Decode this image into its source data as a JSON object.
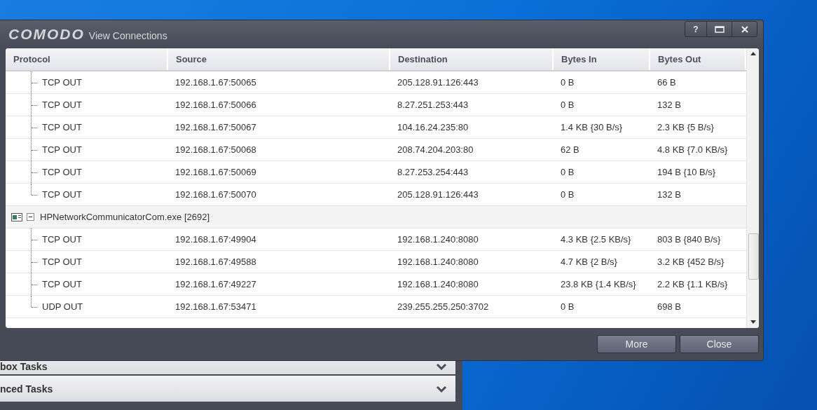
{
  "background_window": {
    "sections": [
      {
        "label": "box Tasks"
      },
      {
        "label": "nced Tasks"
      }
    ]
  },
  "window": {
    "brand": "COMODO",
    "title": "View Connections",
    "help": "?"
  },
  "table": {
    "columns": [
      "Protocol",
      "Source",
      "Destination",
      "Bytes In",
      "Bytes Out"
    ],
    "groups": [
      {
        "children": [
          {
            "protocol": "TCP OUT",
            "source": "192.168.1.67:50065",
            "destination": "205.128.91.126:443",
            "bytes_in": "0 B",
            "bytes_out": "66 B"
          },
          {
            "protocol": "TCP OUT",
            "source": "192.168.1.67:50066",
            "destination": "8.27.251.253:443",
            "bytes_in": "0 B",
            "bytes_out": "132 B"
          },
          {
            "protocol": "TCP OUT",
            "source": "192.168.1.67:50067",
            "destination": "104.16.24.235:80",
            "bytes_in": "1.4 KB {30 B/s}",
            "bytes_out": "2.3 KB {5 B/s}"
          },
          {
            "protocol": "TCP OUT",
            "source": "192.168.1.67:50068",
            "destination": "208.74.204.203:80",
            "bytes_in": "62 B",
            "bytes_out": "4.8 KB {7.0 KB/s}"
          },
          {
            "protocol": "TCP OUT",
            "source": "192.168.1.67:50069",
            "destination": "8.27.253.254:443",
            "bytes_in": "0 B",
            "bytes_out": "194 B {10 B/s}"
          },
          {
            "protocol": "TCP OUT",
            "source": "192.168.1.67:50070",
            "destination": "205.128.91.126:443",
            "bytes_in": "0 B",
            "bytes_out": "132 B"
          }
        ]
      },
      {
        "name": "HPNetworkCommunicatorCom.exe [2692]",
        "expanded": true,
        "children": [
          {
            "protocol": "TCP OUT",
            "source": "192.168.1.67:49904",
            "destination": "192.168.1.240:8080",
            "bytes_in": "4.3 KB {2.5 KB/s}",
            "bytes_out": "803 B {840 B/s}"
          },
          {
            "protocol": "TCP OUT",
            "source": "192.168.1.67:49588",
            "destination": "192.168.1.240:8080",
            "bytes_in": "4.7 KB {2 B/s}",
            "bytes_out": "3.2 KB {452 B/s}"
          },
          {
            "protocol": "TCP OUT",
            "source": "192.168.1.67:49227",
            "destination": "192.168.1.240:8080",
            "bytes_in": "23.8 KB {1.4 KB/s}",
            "bytes_out": "2.2 KB {1.1 KB/s}"
          },
          {
            "protocol": "UDP OUT",
            "source": "192.168.1.67:53471",
            "destination": "239.255.255.250:3702",
            "bytes_in": "0 B",
            "bytes_out": "698 B"
          }
        ]
      }
    ]
  },
  "buttons": [
    "More",
    "Close"
  ]
}
